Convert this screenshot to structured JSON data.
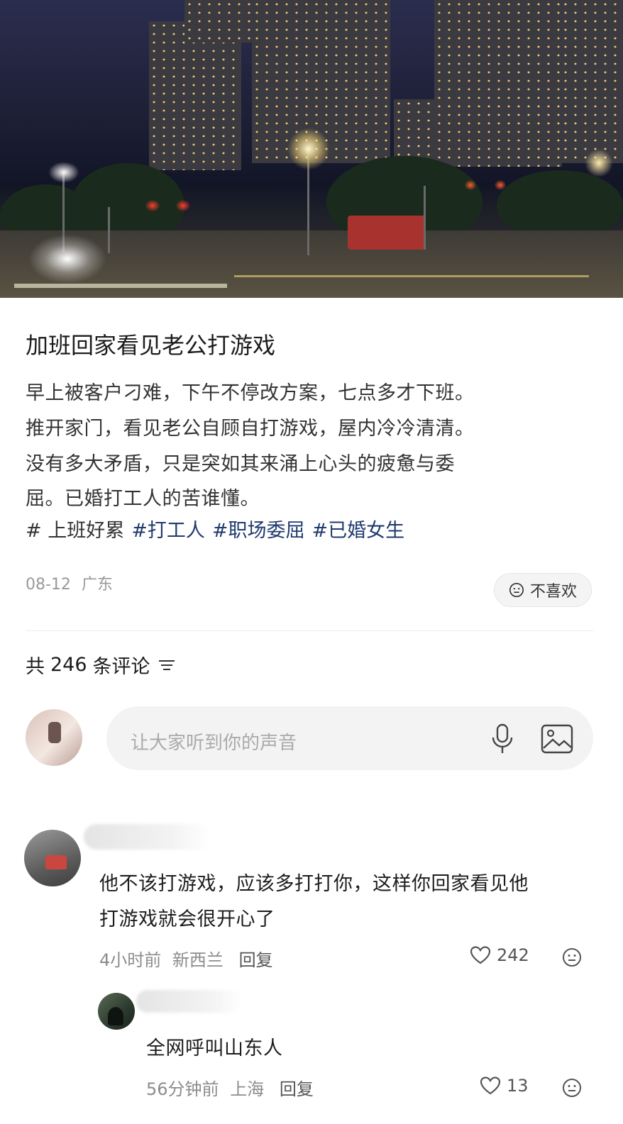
{
  "post": {
    "title": "加班回家看见老公打游戏",
    "body_lines": [
      "早上被客户刁难，下午不停改方案，七点多才下班。",
      "推开家门，看见老公自顾自打游戏，屋内冷冷清清。",
      "没有多大矛盾，只是突如其来涌上心头的疲惫与委",
      "屈。已婚打工人的苦谁懂。"
    ],
    "tags": [
      "# 上班好累",
      "#打工人",
      "#职场委屈",
      "#已婚女生"
    ],
    "date": "08-12",
    "location": "广东",
    "dislike_label": "不喜欢"
  },
  "comments_header": {
    "prefix": "共",
    "count": "246",
    "suffix": "条评论"
  },
  "comment_input": {
    "placeholder": "让大家听到你的声音"
  },
  "comments": [
    {
      "lines": [
        "他不该打游戏，应该多打打你，这样你回家看见他",
        "打游戏就会很开心了"
      ],
      "time": "4小时前",
      "location": "新西兰",
      "reply_label": "回复",
      "likes": "242"
    },
    {
      "lines": [
        "全网呼叫山东人"
      ],
      "time": "56分钟前",
      "location": "上海",
      "reply_label": "回复",
      "likes": "13"
    }
  ],
  "icons": [
    "neutral-face-icon",
    "sort-icon",
    "microphone-icon",
    "image-icon",
    "heart-icon",
    "smile-icon"
  ],
  "colors": {
    "tag": "#203a6e",
    "meta": "#999999",
    "input_bg": "#f3f3f3"
  }
}
